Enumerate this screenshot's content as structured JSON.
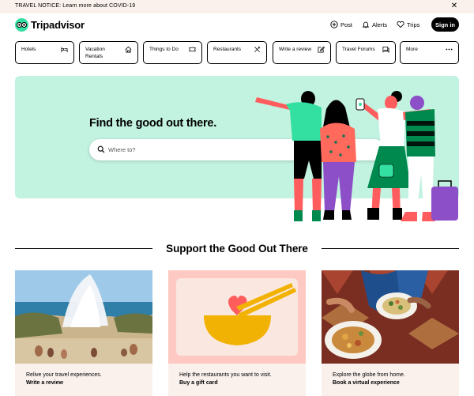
{
  "notice": {
    "text": "TRAVEL NOTICE: Learn more about COVID-19",
    "close_icon": "close-icon"
  },
  "header": {
    "logo_text": "Tripadvisor",
    "post_label": "Post",
    "alerts_label": "Alerts",
    "trips_label": "Trips",
    "signin_label": "Sign in"
  },
  "categories": [
    {
      "label": "Hotels",
      "icon": "bed-icon"
    },
    {
      "label": "Vacation Rentals",
      "icon": "house-icon"
    },
    {
      "label": "Things to Do",
      "icon": "ticket-icon"
    },
    {
      "label": "Restaurants",
      "icon": "utensils-icon"
    },
    {
      "label": "Write a review",
      "icon": "pencil-icon"
    },
    {
      "label": "Travel Forums",
      "icon": "chat-icon"
    },
    {
      "label": "More",
      "icon": "more-dots-icon"
    }
  ],
  "hero": {
    "title": "Find the good out there.",
    "search_placeholder": "Where to?"
  },
  "section": {
    "title": "Support the Good Out There"
  },
  "cards": [
    {
      "text": "Relive your travel experiences.",
      "link": "Write a review"
    },
    {
      "text": "Help the restaurants you want to visit.",
      "link": "Buy a gift card"
    },
    {
      "text": "Explore the globe from home.",
      "link": "Book a virtual experience"
    }
  ],
  "colors": {
    "brand_green": "#34e0a1",
    "hero_bg": "#c2f2e0",
    "card_bg": "#faf1ed",
    "notice_bg": "#faf1ed"
  }
}
